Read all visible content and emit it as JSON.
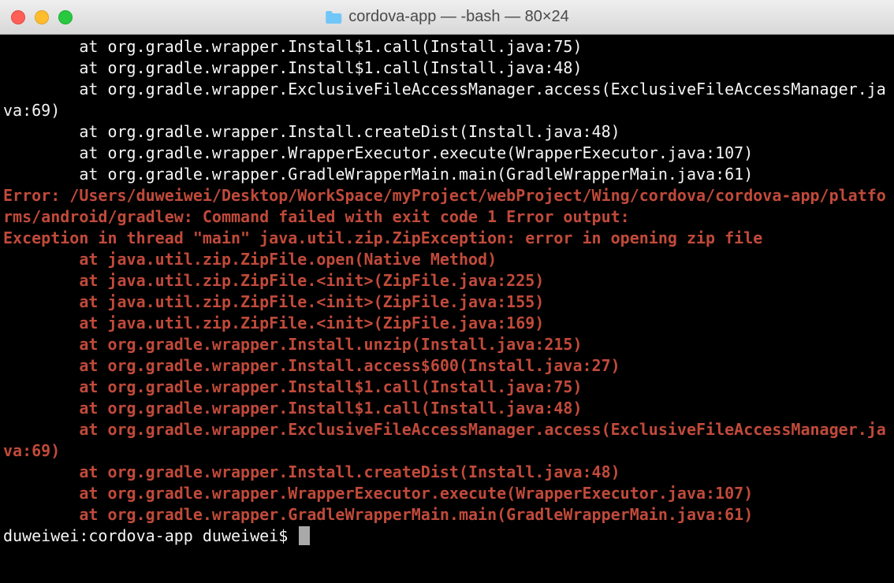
{
  "window": {
    "title": "cordova-app — -bash — 80×24",
    "folder_icon_color": "#71c6f8"
  },
  "terminal": {
    "white_lines": [
      "        at org.gradle.wrapper.Install$1.call(Install.java:75)",
      "        at org.gradle.wrapper.Install$1.call(Install.java:48)",
      "        at org.gradle.wrapper.ExclusiveFileAccessManager.access(ExclusiveFileAccessManager.java:69)",
      "        at org.gradle.wrapper.Install.createDist(Install.java:48)",
      "        at org.gradle.wrapper.WrapperExecutor.execute(WrapperExecutor.java:107)",
      "        at org.gradle.wrapper.GradleWrapperMain.main(GradleWrapperMain.java:61)"
    ],
    "error_lines": [
      "Error: /Users/duweiwei/Desktop/WorkSpace/myProject/webProject/Wing/cordova/cordova-app/platforms/android/gradlew: Command failed with exit code 1 Error output:",
      "Exception in thread \"main\" java.util.zip.ZipException: error in opening zip file",
      "        at java.util.zip.ZipFile.open(Native Method)",
      "        at java.util.zip.ZipFile.<init>(ZipFile.java:225)",
      "        at java.util.zip.ZipFile.<init>(ZipFile.java:155)",
      "        at java.util.zip.ZipFile.<init>(ZipFile.java:169)",
      "        at org.gradle.wrapper.Install.unzip(Install.java:215)",
      "        at org.gradle.wrapper.Install.access$600(Install.java:27)",
      "        at org.gradle.wrapper.Install$1.call(Install.java:75)",
      "        at org.gradle.wrapper.Install$1.call(Install.java:48)",
      "        at org.gradle.wrapper.ExclusiveFileAccessManager.access(ExclusiveFileAccessManager.java:69)",
      "        at org.gradle.wrapper.Install.createDist(Install.java:48)",
      "        at org.gradle.wrapper.WrapperExecutor.execute(WrapperExecutor.java:107)",
      "        at org.gradle.wrapper.GradleWrapperMain.main(GradleWrapperMain.java:61)"
    ],
    "prompt": "duweiwei:cordova-app duweiwei$ "
  }
}
